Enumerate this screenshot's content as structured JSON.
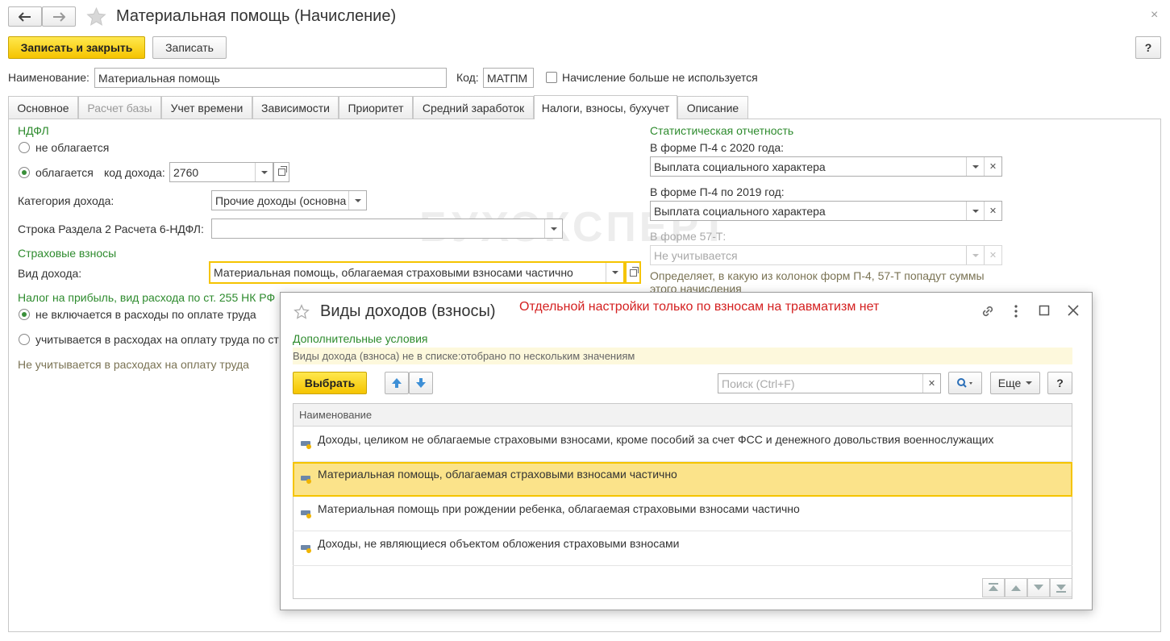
{
  "window": {
    "title": "Материальная помощь (Начисление)",
    "close_glyph": "×"
  },
  "toolbar": {
    "save_close": "Записать и закрыть",
    "save": "Записать",
    "help": "?"
  },
  "header": {
    "name_label": "Наименование:",
    "name_value": "Материальная помощь",
    "code_label": "Код:",
    "code_value": "МАТПМ",
    "not_used_label": "Начисление больше не используется"
  },
  "tabs": [
    {
      "label": "Основное",
      "state": "normal"
    },
    {
      "label": "Расчет базы",
      "state": "disabled"
    },
    {
      "label": "Учет времени",
      "state": "normal"
    },
    {
      "label": "Зависимости",
      "state": "normal"
    },
    {
      "label": "Приоритет",
      "state": "normal"
    },
    {
      "label": "Средний заработок",
      "state": "normal"
    },
    {
      "label": "Налоги, взносы, бухучет",
      "state": "active"
    },
    {
      "label": "Описание",
      "state": "normal"
    }
  ],
  "ndfl": {
    "heading": "НДФЛ",
    "opt_not_taxed": "не облагается",
    "opt_taxed": "облагается",
    "income_code_label": "код дохода:",
    "income_code_value": "2760",
    "category_label": "Категория дохода:",
    "category_value": "Прочие доходы (основна",
    "line_label": "Строка Раздела 2 Расчета 6-НДФЛ:",
    "line_value": ""
  },
  "insurance": {
    "heading": "Страховые взносы",
    "income_type_label": "Вид дохода:",
    "income_type_value": "Материальная помощь, облагаемая страховыми взносами частично"
  },
  "profit_tax": {
    "heading": "Налог на прибыль, вид расхода по ст. 255 НК РФ",
    "opt_not_included": "не включается в расходы по оплате труда",
    "opt_included": "учитывается в расходах на оплату труда по ст",
    "note": "Не учитывается в расходах на оплату труда"
  },
  "statistics": {
    "heading": "Статистическая отчетность",
    "p4_2020_label": "В форме П-4 с 2020 года:",
    "p4_2020_value": "Выплата социального характера",
    "p4_2019_label": "В форме П-4 по 2019 год:",
    "p4_2019_value": "Выплата социального характера",
    "f57t_label": "В форме 57-Т:",
    "f57t_value": "Не учитывается",
    "note_line1": "Определяет, в какую из колонок форм П-4, 57-Т попадут суммы",
    "note_line2": "этого начисления"
  },
  "watermark": "БУХЭКСПЕРТ",
  "dialog": {
    "title": "Виды доходов (взносы)",
    "annotation": "Отдельной настройки только по взносам на травматизм нет",
    "annotation_color": "#d42020",
    "extra_conditions": "Дополнительные условия",
    "filter_note": "Виды дохода (взноса) не в списке:отобрано по нескольким значениям",
    "select_button": "Выбрать",
    "search_placeholder": "Поиск (Ctrl+F)",
    "more_button": "Еще",
    "help_button": "?",
    "column_header": "Наименование",
    "rows": [
      "Доходы, целиком не облагаемые страховыми взносами, кроме пособий за счет ФСС и денежного довольствия военнослужащих",
      "Материальная помощь, облагаемая страховыми взносами частично",
      "Материальная помощь при рождении ребенка, облагаемая страховыми взносами частично",
      "Доходы, не являющиеся объектом обложения страховыми взносами"
    ],
    "selected_index": 1
  },
  "colors": {
    "accent_yellow": "#f5c400",
    "section_green": "#2e8b2e",
    "selected_row": "#fbe38a"
  }
}
